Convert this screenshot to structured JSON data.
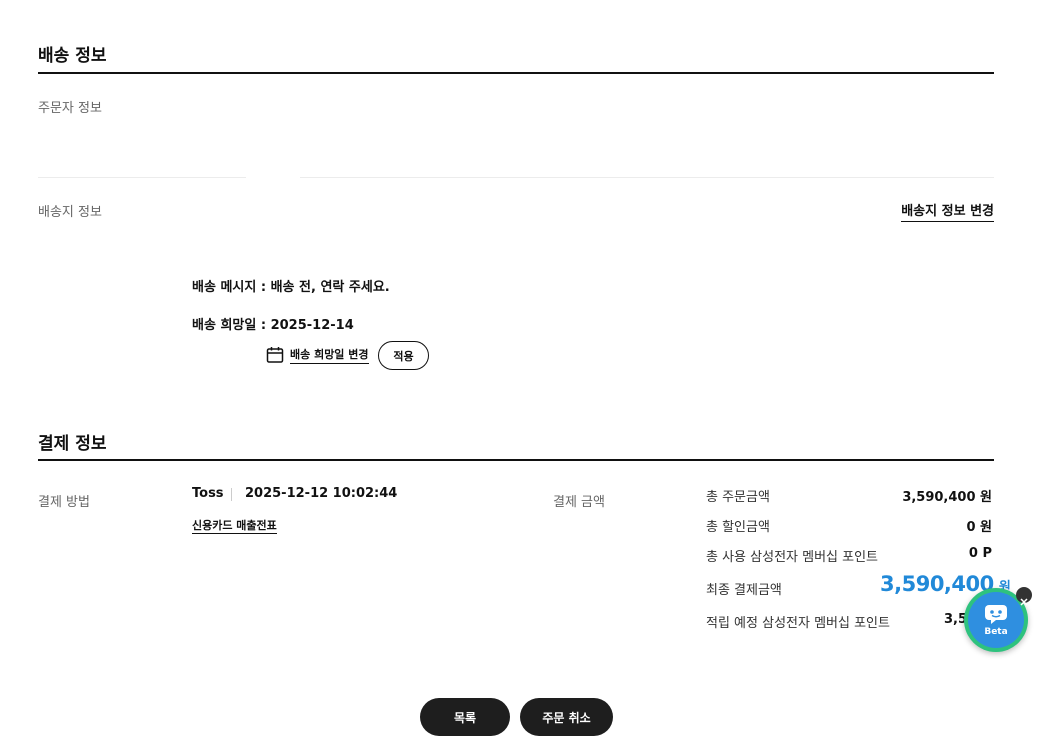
{
  "delivery": {
    "section_title": "배송 정보",
    "orderer_label": "주문자 정보",
    "address_label": "배송지 정보",
    "change_address_link": "배송지 정보 변경",
    "message_label": "배송 메시지 :",
    "message_value": "배송 전, 연락 주세요.",
    "hope_date_label": "배송 희망일 :",
    "hope_date_value": "2025-12-14",
    "change_hope_date_link": "배송 희망일 변경",
    "apply_button": "적용"
  },
  "payment": {
    "section_title": "결제 정보",
    "method_label": "결제 방법",
    "method_value": "Toss",
    "paid_at": "2025-12-12 10:02:44",
    "receipt_link": "신용카드 매출전표",
    "amount_label": "결제 금액",
    "summary": [
      {
        "label": "총 주문금액",
        "value": "3,590,400 원"
      },
      {
        "label": "총 할인금액",
        "value": "0 원"
      },
      {
        "label": "총 사용 삼성전자 멤버십 포인트",
        "value": "0 P"
      }
    ],
    "final_label": "최종 결제금액",
    "final_value": "3,590,400",
    "final_unit": "원",
    "points_label": "적립 예정 삼성전자 멤버십 포인트",
    "points_value": "3,5"
  },
  "actions": {
    "list_button": "목록",
    "cancel_button": "주문 취소"
  },
  "chatbot": {
    "badge": "Beta",
    "accent_color": "#2ec27e",
    "icon_color": "#2f8fe0"
  }
}
